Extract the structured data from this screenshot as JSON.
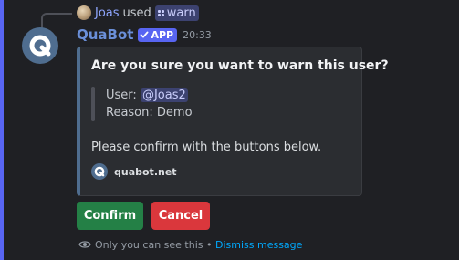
{
  "reply": {
    "user": "Joas",
    "used_text": "used",
    "command": "warn"
  },
  "message": {
    "author": "QuaBot",
    "badge": "APP",
    "timestamp": "20:33"
  },
  "embed": {
    "title": "Are you sure you want to warn this user?",
    "user_label": "User:",
    "user_mention": "@Joas2",
    "reason_label": "Reason:",
    "reason_value": "Demo",
    "description": "Please confirm with the buttons below.",
    "footer": "quabot.net"
  },
  "buttons": {
    "confirm": "Confirm",
    "cancel": "Cancel"
  },
  "ephemeral": {
    "notice": "Only you can see this",
    "separator": "•",
    "dismiss": "Dismiss message"
  },
  "colors": {
    "background": "#1f2024",
    "accent_bar": "#5865f2",
    "embed_border": "#4f6d8f",
    "confirm": "#248046",
    "cancel": "#da373c",
    "link": "#00a8fc"
  },
  "icons": {
    "reply_avatar": "user-avatar-icon",
    "command": "slash-command-icon",
    "app_check": "check-icon",
    "bot_avatar": "quabot-logo-icon",
    "ephemeral": "eye-icon"
  }
}
